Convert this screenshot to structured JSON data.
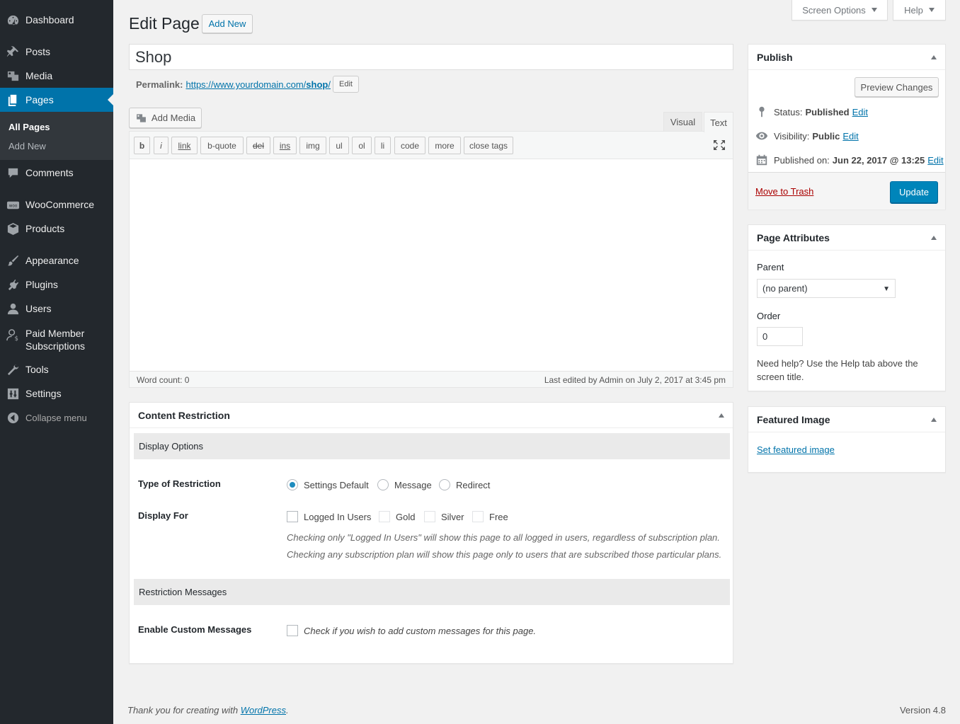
{
  "sidebar": {
    "items": [
      {
        "label": "Dashboard",
        "icon": "dashboard-icon"
      },
      {
        "label": "Posts",
        "icon": "pin-icon"
      },
      {
        "label": "Media",
        "icon": "media-icon"
      },
      {
        "label": "Pages",
        "icon": "pages-icon"
      },
      {
        "label": "Comments",
        "icon": "comment-icon"
      },
      {
        "label": "WooCommerce",
        "icon": "woocommerce-icon"
      },
      {
        "label": "Products",
        "icon": "box-icon"
      },
      {
        "label": "Appearance",
        "icon": "brush-icon"
      },
      {
        "label": "Plugins",
        "icon": "plug-icon"
      },
      {
        "label": "Users",
        "icon": "user-icon"
      },
      {
        "label": "Paid Member Subscriptions",
        "label_line1": "Paid Member",
        "label_line2": "Subscriptions",
        "icon": "member-icon"
      },
      {
        "label": "Tools",
        "icon": "wrench-icon"
      },
      {
        "label": "Settings",
        "icon": "settings-icon"
      },
      {
        "label": "Collapse menu",
        "icon": "collapse-icon"
      }
    ],
    "submenu": [
      "All Pages",
      "Add New"
    ]
  },
  "screen_options": {
    "label": "Screen Options",
    "help": "Help"
  },
  "header": {
    "title": "Edit Page",
    "add_new": "Add New"
  },
  "post": {
    "title": "Shop",
    "permalink_label": "Permalink:",
    "permalink_url": "https://www.yourdomain.com/shop/",
    "permalink_base": "https://www.yourdomain.com/",
    "permalink_slug": "shop",
    "edit": "Edit"
  },
  "editor": {
    "add_media": "Add Media",
    "tabs": [
      "Visual",
      "Text"
    ],
    "quicktags": [
      "b",
      "i",
      "link",
      "b-quote",
      "del",
      "ins",
      "img",
      "ul",
      "ol",
      "li",
      "code",
      "more",
      "close tags"
    ],
    "word_count": "Word count: 0",
    "last_edited": "Last edited by Admin on July 2, 2017 at 3:45 pm"
  },
  "restriction": {
    "title": "Content Restriction",
    "display_options": "Display Options",
    "type_label": "Type of Restriction",
    "type_options": [
      "Settings Default",
      "Message",
      "Redirect"
    ],
    "type_selected": "Settings Default",
    "display_for_label": "Display For",
    "display_for_options": [
      "Logged In Users",
      "Gold",
      "Silver",
      "Free"
    ],
    "hint1": "Checking only \"Logged In Users\" will show this page to all logged in users, regardless of subscription plan.",
    "hint2": "Checking any subscription plan will show this page only to users that are subscribed those particular plans.",
    "messages_title": "Restriction Messages",
    "custom_label": "Enable Custom Messages",
    "custom_hint": "Check if you wish to add custom messages for this page."
  },
  "publish": {
    "title": "Publish",
    "preview": "Preview Changes",
    "status_label": "Status:",
    "status_value": "Published",
    "visibility_label": "Visibility:",
    "visibility_value": "Public",
    "published_label": "Published on:",
    "published_value": "Jun 22, 2017 @ 13:25",
    "edit": "Edit",
    "trash": "Move to Trash",
    "update": "Update"
  },
  "attributes": {
    "title": "Page Attributes",
    "parent_label": "Parent",
    "parent_value": "(no parent)",
    "order_label": "Order",
    "order_value": "0",
    "help": "Need help? Use the Help tab above the screen title."
  },
  "featured": {
    "title": "Featured Image",
    "link": "Set featured image"
  },
  "footer": {
    "thanks": "Thank you for creating with ",
    "wp": "WordPress",
    "period": ".",
    "version": "Version 4.8"
  },
  "colors": {
    "sidebar_bg": "#23282d",
    "accent": "#0073aa",
    "update_button": "#0085ba",
    "trash": "#a00"
  }
}
